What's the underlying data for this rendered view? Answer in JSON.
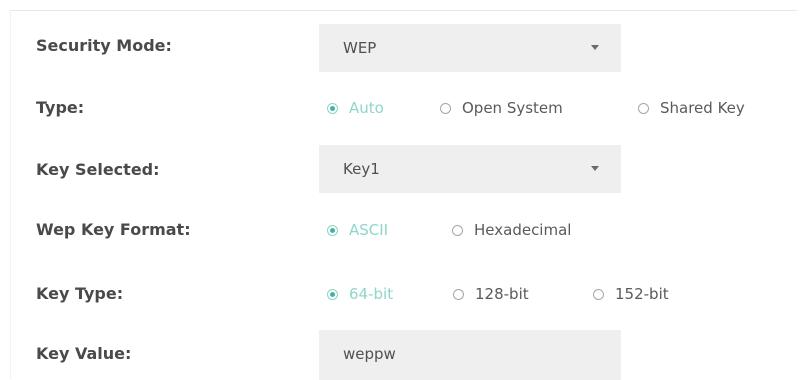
{
  "form": {
    "security_mode": {
      "label": "Security Mode:",
      "value": "WEP"
    },
    "type": {
      "label": "Type:",
      "options": [
        "Auto",
        "Open System",
        "Shared Key"
      ],
      "selected": "Auto"
    },
    "key_selected": {
      "label": "Key Selected:",
      "value": "Key1"
    },
    "wep_key_format": {
      "label": "Wep Key Format:",
      "options": [
        "ASCII",
        "Hexadecimal"
      ],
      "selected": "ASCII"
    },
    "key_type": {
      "label": "Key Type:",
      "options": [
        "64-bit",
        "128-bit",
        "152-bit"
      ],
      "selected": "64-bit"
    },
    "key_value": {
      "label": "Key Value:",
      "value": "weppw"
    }
  },
  "colors": {
    "accent": "#3fb5a5",
    "field_background": "#efefef",
    "label_text": "#4a4a4a"
  },
  "icons": {
    "dropdown": "chevron-down-icon",
    "radio": "radio-icon"
  }
}
